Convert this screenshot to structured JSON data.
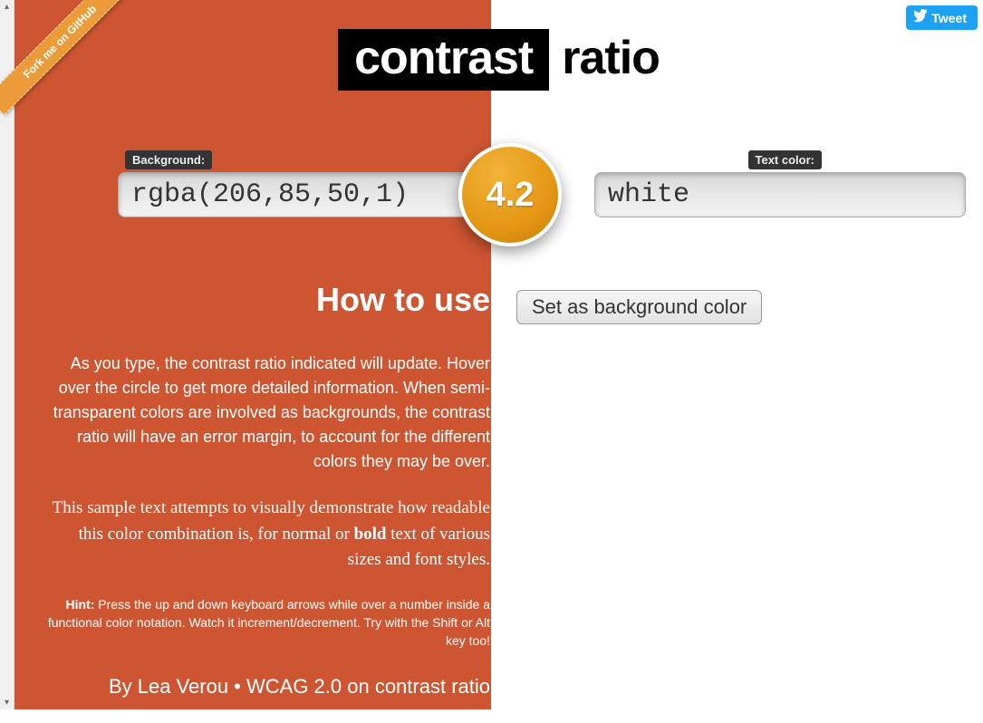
{
  "ribbon": {
    "label": "Fork me on GitHub"
  },
  "tweet": {
    "label": "Tweet"
  },
  "title": {
    "word1": "contrast",
    "word2": "ratio"
  },
  "labels": {
    "background": "Background:",
    "textcolor": "Text color:"
  },
  "inputs": {
    "background": "rgba(206,85,50,1)",
    "foreground": "white"
  },
  "ratio": {
    "value": "4.2"
  },
  "buttons": {
    "set_bg": "Set as background color"
  },
  "howto": {
    "heading": "How to use",
    "p1": "As you type, the contrast ratio indicated will update. Hover over the circle to get more detailed information. When semi-transparent colors are involved as backgrounds, the contrast ratio will have an error margin, to account for the different colors they may be over.",
    "p2a": "This sample text attempts to visually demonstrate how readable this color combination is, for normal or ",
    "p2b": "bold",
    "p2c": " text of various sizes and font styles.",
    "hint_label": "Hint:",
    "hint": " Press the up and down keyboard arrows while over a number inside a functional color notation. Watch it increment/decrement. Try with the Shift or Alt key too!",
    "byline": "By Lea Verou • WCAG 2.0 on contrast ratio"
  },
  "colors": {
    "bg": "rgba(206,85,50,1)"
  }
}
